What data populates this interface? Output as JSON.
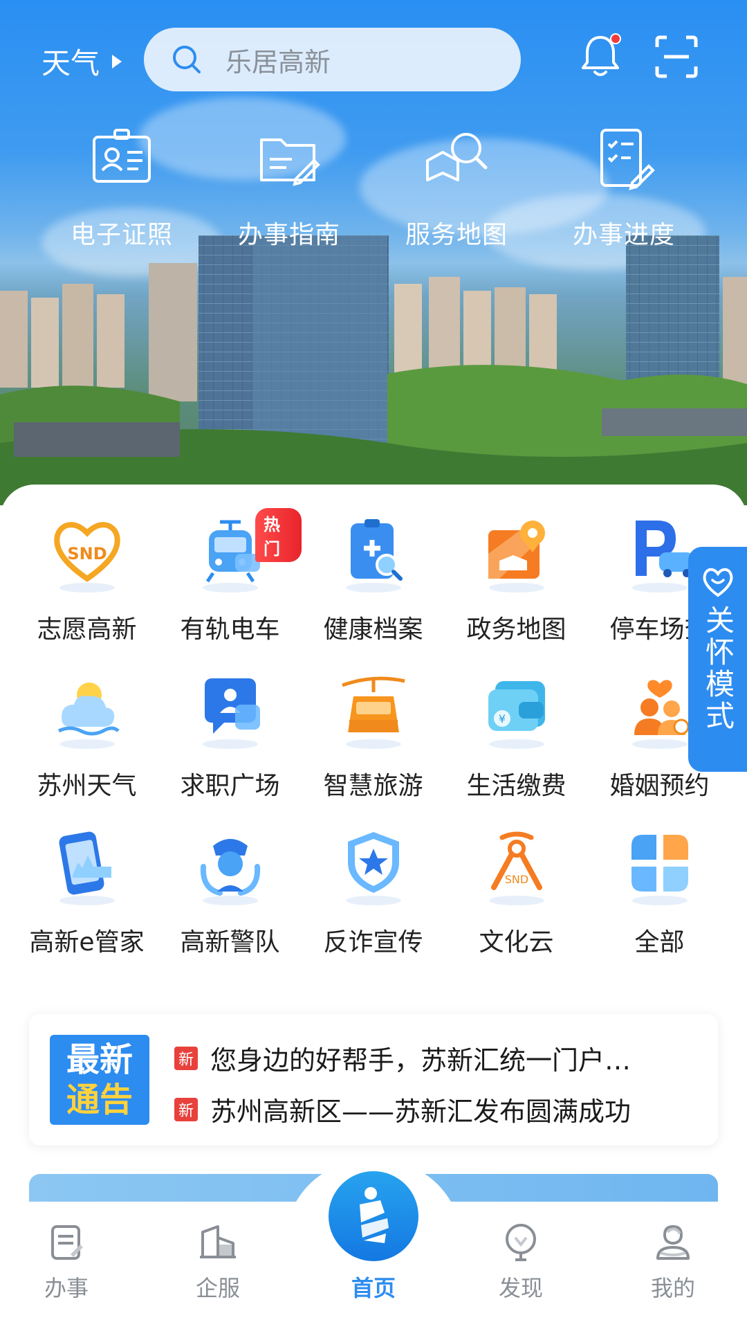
{
  "header": {
    "weather_label": "天气",
    "search_placeholder": "乐居高新"
  },
  "quick_actions": [
    {
      "label": "电子证照",
      "icon": "id-card-icon"
    },
    {
      "label": "办事指南",
      "icon": "guide-folder-icon"
    },
    {
      "label": "服务地图",
      "icon": "map-search-icon"
    },
    {
      "label": "办事进度",
      "icon": "progress-doc-icon"
    }
  ],
  "services": [
    {
      "label": "志愿高新",
      "icon": "volunteer-heart-icon"
    },
    {
      "label": "有轨电车",
      "icon": "tram-icon",
      "badge": "热门"
    },
    {
      "label": "健康档案",
      "icon": "health-record-icon"
    },
    {
      "label": "政务地图",
      "icon": "gov-map-icon"
    },
    {
      "label": "停车场查",
      "icon": "parking-icon"
    },
    {
      "label": "苏州天气",
      "icon": "weather-cloud-icon"
    },
    {
      "label": "求职广场",
      "icon": "job-chat-icon"
    },
    {
      "label": "智慧旅游",
      "icon": "cable-car-icon"
    },
    {
      "label": "生活缴费",
      "icon": "wallet-icon"
    },
    {
      "label": "婚姻预约",
      "icon": "couple-icon"
    },
    {
      "label": "高新e管家",
      "icon": "phone-city-icon"
    },
    {
      "label": "高新警队",
      "icon": "police-icon"
    },
    {
      "label": "反诈宣传",
      "icon": "shield-star-icon"
    },
    {
      "label": "文化云",
      "icon": "culture-cloud-icon"
    },
    {
      "label": "全部",
      "icon": "all-grid-icon"
    }
  ],
  "care_mode": {
    "label": "关怀模式"
  },
  "notice": {
    "badge_line1": "最新",
    "badge_line2": "通告",
    "new_tag": "新",
    "items": [
      "您身边的好帮手，苏新汇统一门户…",
      "苏州高新区——苏新汇发布圆满成功"
    ]
  },
  "tabs": [
    {
      "label": "办事",
      "icon": "clipboard-icon"
    },
    {
      "label": "企服",
      "icon": "building-icon"
    },
    {
      "label": "首页",
      "icon": "home-logo-icon",
      "active": true
    },
    {
      "label": "发现",
      "icon": "discover-icon"
    },
    {
      "label": "我的",
      "icon": "profile-icon"
    }
  ],
  "colors": {
    "primary": "#2d8cf0",
    "badge_red": "#e8413c",
    "notice_yellow": "#ffd23c"
  }
}
